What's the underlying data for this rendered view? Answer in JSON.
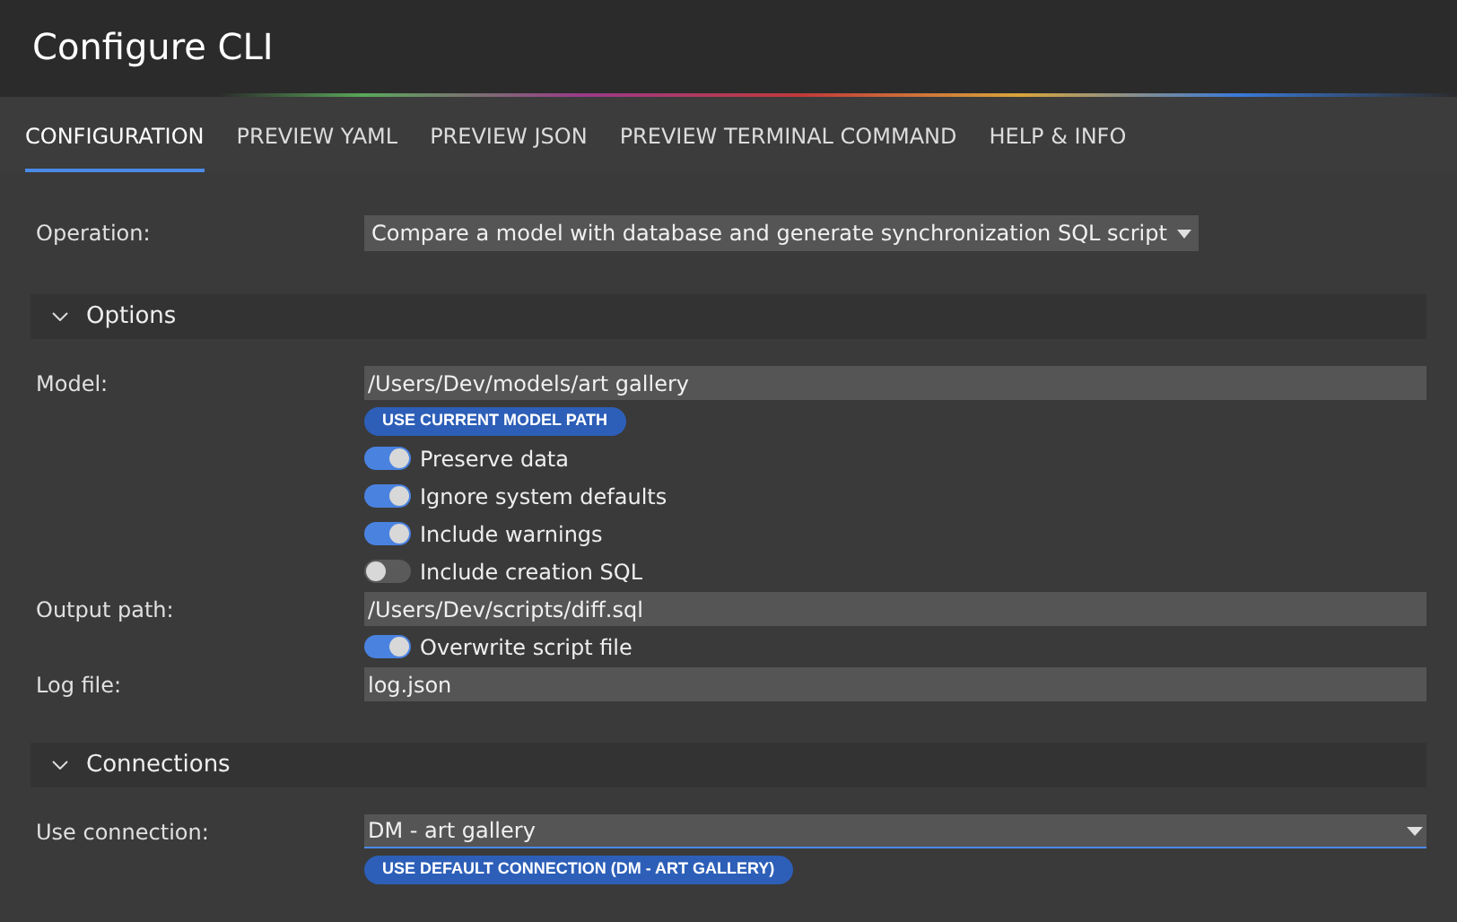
{
  "window": {
    "title": "Configure CLI"
  },
  "tabs": [
    {
      "label": "CONFIGURATION",
      "selected": true
    },
    {
      "label": "PREVIEW YAML",
      "selected": false
    },
    {
      "label": "PREVIEW JSON",
      "selected": false
    },
    {
      "label": "PREVIEW TERMINAL COMMAND",
      "selected": false
    },
    {
      "label": "HELP & INFO",
      "selected": false
    }
  ],
  "operation": {
    "label": "Operation:",
    "value": "Compare a model with database and generate synchronization SQL script"
  },
  "sections": [
    {
      "title": "Options",
      "expanded": true,
      "rows": [
        {
          "kind": "text",
          "label": "Model:",
          "value": "/Users/Dev/models/art gallery"
        },
        {
          "kind": "button",
          "label": "USE CURRENT MODEL PATH"
        },
        {
          "kind": "toggle",
          "label": "Preserve data",
          "on": true
        },
        {
          "kind": "toggle",
          "label": "Ignore system defaults",
          "on": true
        },
        {
          "kind": "toggle",
          "label": "Include warnings",
          "on": true
        },
        {
          "kind": "toggle",
          "label": "Include creation SQL",
          "on": false
        },
        {
          "kind": "text",
          "label": "Output path:",
          "value": "/Users/Dev/scripts/diff.sql"
        },
        {
          "kind": "toggle",
          "label": "Overwrite script file",
          "on": true
        },
        {
          "kind": "text",
          "label": "Log file:",
          "value": "log.json"
        }
      ]
    },
    {
      "title": "Connections",
      "expanded": true,
      "rows": [
        {
          "kind": "select",
          "label": "Use connection:",
          "value": "DM - art gallery"
        },
        {
          "kind": "button",
          "label": "USE DEFAULT CONNECTION (DM - ART GALLERY)"
        }
      ]
    }
  ]
}
